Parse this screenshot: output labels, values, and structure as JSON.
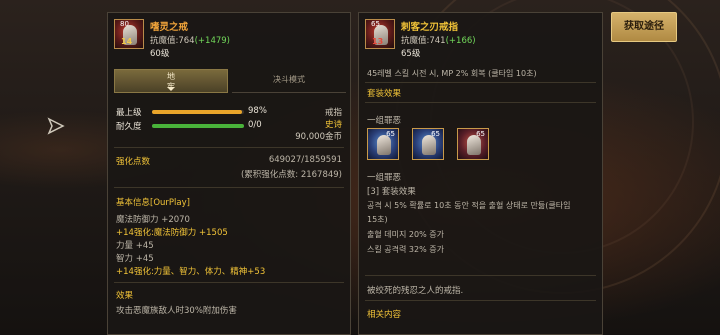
{
  "acquire_button": "获取途径",
  "left": {
    "icon_level": "80",
    "icon_enhance": "14",
    "name": "嗜灵之戒",
    "stat_label": "抗魔值:764",
    "stat_bonus": "(+1479)",
    "level": "60级",
    "tab_active_line1": "地",
    "tab_active_line2": "牢",
    "tab_inactive": "决斗模式",
    "bars": [
      {
        "label": "最上级",
        "value": "98%",
        "fill_percent": 98,
        "color": "#e9a52a"
      },
      {
        "label": "耐久度",
        "value": "0/0",
        "fill_percent": 100,
        "color": "#49b33a"
      }
    ],
    "type": "戒指",
    "rarity": "史诗",
    "price": "90,000金币",
    "enhance_points_label": "强化点数",
    "enhance_points_value": "649027/1859591",
    "enhance_points_total": "(累积强化点数: 2167849)",
    "basic_title": "基本信息[OurPlay]",
    "basic_lines": [
      "魔法防御力 +2070",
      "+14强化:魔法防御力 +1505",
      "力量 +45",
      "智力 +45",
      "+14强化:力量、智力、体力、精神+53"
    ],
    "effect_title": "效果",
    "effect_text": "攻击恶魔族敌人时30%附加伤害"
  },
  "right": {
    "icon_level": "65",
    "icon_enhance": "13",
    "name": "刺客之刃戒指",
    "stat_label": "抗魔值:741",
    "stat_bonus": "(+166)",
    "level": "65级",
    "top_text": "45레벨 스킬 시전 시, MP 2% 회복 (쿨타임 10초)",
    "set_title": "套装效果",
    "set_name": "一组罪恶",
    "set_icon_levels": [
      "65",
      "65",
      "65"
    ],
    "set_name2": "一组罪恶",
    "set_count": "[3] 套装效果",
    "set_lines": [
      "공격 시 5% 확률로 10초 동안 적을 출혈 상태로 만듦(쿨타임",
      "15초)",
      "출혈 데미지 20% 증가",
      "스킬 공격력 32% 증가"
    ],
    "flavor": "被绞死的残忍之人的戒指.",
    "related": "相关内容"
  }
}
